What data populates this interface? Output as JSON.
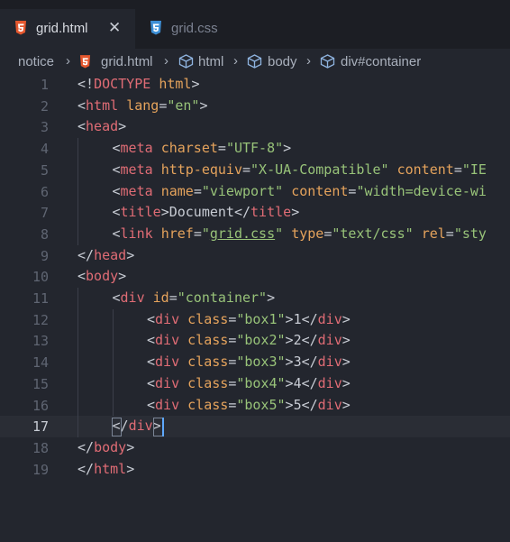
{
  "tabs": [
    {
      "label": "grid.html",
      "icon": "html5-icon",
      "active": true,
      "close": "✕"
    },
    {
      "label": "grid.css",
      "icon": "css3-icon",
      "active": false
    }
  ],
  "breadcrumb": {
    "items": [
      "notice",
      "grid.html",
      "html",
      "body",
      "div#container"
    ],
    "separator": "›"
  },
  "editor": {
    "current_line": 17,
    "lines": [
      {
        "n": "1",
        "indent": 0,
        "tokens": [
          [
            "br",
            "<!"
          ],
          [
            "tag",
            "DOCTYPE"
          ],
          [
            "txt",
            " "
          ],
          [
            "attr",
            "html"
          ],
          [
            "br",
            ">"
          ]
        ]
      },
      {
        "n": "2",
        "indent": 0,
        "tokens": [
          [
            "br",
            "<"
          ],
          [
            "tag",
            "html"
          ],
          [
            "txt",
            " "
          ],
          [
            "attr",
            "lang"
          ],
          [
            "br",
            "="
          ],
          [
            "str",
            "\"en\""
          ],
          [
            "br",
            ">"
          ]
        ]
      },
      {
        "n": "3",
        "indent": 0,
        "tokens": [
          [
            "br",
            "<"
          ],
          [
            "tag",
            "head"
          ],
          [
            "br",
            ">"
          ]
        ]
      },
      {
        "n": "4",
        "indent": 1,
        "tokens": [
          [
            "br",
            "<"
          ],
          [
            "tag",
            "meta"
          ],
          [
            "txt",
            " "
          ],
          [
            "attr",
            "charset"
          ],
          [
            "br",
            "="
          ],
          [
            "str",
            "\"UTF-8\""
          ],
          [
            "br",
            ">"
          ]
        ]
      },
      {
        "n": "5",
        "indent": 1,
        "tokens": [
          [
            "br",
            "<"
          ],
          [
            "tag",
            "meta"
          ],
          [
            "txt",
            " "
          ],
          [
            "attr",
            "http-equiv"
          ],
          [
            "br",
            "="
          ],
          [
            "str",
            "\"X-UA-Compatible\""
          ],
          [
            "txt",
            " "
          ],
          [
            "attr",
            "content"
          ],
          [
            "br",
            "="
          ],
          [
            "str",
            "\"IE"
          ]
        ]
      },
      {
        "n": "6",
        "indent": 1,
        "tokens": [
          [
            "br",
            "<"
          ],
          [
            "tag",
            "meta"
          ],
          [
            "txt",
            " "
          ],
          [
            "attr",
            "name"
          ],
          [
            "br",
            "="
          ],
          [
            "str",
            "\"viewport\""
          ],
          [
            "txt",
            " "
          ],
          [
            "attr",
            "content"
          ],
          [
            "br",
            "="
          ],
          [
            "str",
            "\"width=device-wi"
          ]
        ]
      },
      {
        "n": "7",
        "indent": 1,
        "tokens": [
          [
            "br",
            "<"
          ],
          [
            "tag",
            "title"
          ],
          [
            "br",
            ">"
          ],
          [
            "txt",
            "Document"
          ],
          [
            "br",
            "</"
          ],
          [
            "tag",
            "title"
          ],
          [
            "br",
            ">"
          ]
        ]
      },
      {
        "n": "8",
        "indent": 1,
        "tokens": [
          [
            "br",
            "<"
          ],
          [
            "tag",
            "link"
          ],
          [
            "txt",
            " "
          ],
          [
            "attr",
            "href"
          ],
          [
            "br",
            "="
          ],
          [
            "str",
            "\""
          ],
          [
            "link",
            "grid.css"
          ],
          [
            "str",
            "\""
          ],
          [
            "txt",
            " "
          ],
          [
            "attr",
            "type"
          ],
          [
            "br",
            "="
          ],
          [
            "str",
            "\"text/css\""
          ],
          [
            "txt",
            " "
          ],
          [
            "attr",
            "rel"
          ],
          [
            "br",
            "="
          ],
          [
            "str",
            "\"sty"
          ]
        ]
      },
      {
        "n": "9",
        "indent": 0,
        "tokens": [
          [
            "br",
            "</"
          ],
          [
            "tag",
            "head"
          ],
          [
            "br",
            ">"
          ]
        ]
      },
      {
        "n": "10",
        "indent": 0,
        "tokens": [
          [
            "br",
            "<"
          ],
          [
            "tag",
            "body"
          ],
          [
            "br",
            ">"
          ]
        ]
      },
      {
        "n": "11",
        "indent": 1,
        "tokens": [
          [
            "br",
            "<"
          ],
          [
            "tag",
            "div"
          ],
          [
            "txt",
            " "
          ],
          [
            "attr",
            "id"
          ],
          [
            "br",
            "="
          ],
          [
            "str",
            "\"container\""
          ],
          [
            "br",
            ">"
          ]
        ]
      },
      {
        "n": "12",
        "indent": 2,
        "tokens": [
          [
            "br",
            "<"
          ],
          [
            "tag",
            "div"
          ],
          [
            "txt",
            " "
          ],
          [
            "attr",
            "class"
          ],
          [
            "br",
            "="
          ],
          [
            "str",
            "\"box1\""
          ],
          [
            "br",
            ">"
          ],
          [
            "txt",
            "1"
          ],
          [
            "br",
            "</"
          ],
          [
            "tag",
            "div"
          ],
          [
            "br",
            ">"
          ]
        ]
      },
      {
        "n": "13",
        "indent": 2,
        "tokens": [
          [
            "br",
            "<"
          ],
          [
            "tag",
            "div"
          ],
          [
            "txt",
            " "
          ],
          [
            "attr",
            "class"
          ],
          [
            "br",
            "="
          ],
          [
            "str",
            "\"box2\""
          ],
          [
            "br",
            ">"
          ],
          [
            "txt",
            "2"
          ],
          [
            "br",
            "</"
          ],
          [
            "tag",
            "div"
          ],
          [
            "br",
            ">"
          ]
        ]
      },
      {
        "n": "14",
        "indent": 2,
        "tokens": [
          [
            "br",
            "<"
          ],
          [
            "tag",
            "div"
          ],
          [
            "txt",
            " "
          ],
          [
            "attr",
            "class"
          ],
          [
            "br",
            "="
          ],
          [
            "str",
            "\"box3\""
          ],
          [
            "br",
            ">"
          ],
          [
            "txt",
            "3"
          ],
          [
            "br",
            "</"
          ],
          [
            "tag",
            "div"
          ],
          [
            "br",
            ">"
          ]
        ]
      },
      {
        "n": "15",
        "indent": 2,
        "tokens": [
          [
            "br",
            "<"
          ],
          [
            "tag",
            "div"
          ],
          [
            "txt",
            " "
          ],
          [
            "attr",
            "class"
          ],
          [
            "br",
            "="
          ],
          [
            "str",
            "\"box4\""
          ],
          [
            "br",
            ">"
          ],
          [
            "txt",
            "4"
          ],
          [
            "br",
            "</"
          ],
          [
            "tag",
            "div"
          ],
          [
            "br",
            ">"
          ]
        ]
      },
      {
        "n": "16",
        "indent": 2,
        "tokens": [
          [
            "br",
            "<"
          ],
          [
            "tag",
            "div"
          ],
          [
            "txt",
            " "
          ],
          [
            "attr",
            "class"
          ],
          [
            "br",
            "="
          ],
          [
            "str",
            "\"box5\""
          ],
          [
            "br",
            ">"
          ],
          [
            "txt",
            "5"
          ],
          [
            "br",
            "</"
          ],
          [
            "tag",
            "div"
          ],
          [
            "br",
            ">"
          ]
        ]
      },
      {
        "n": "17",
        "indent": 1,
        "tokens": [
          [
            "br",
            "</"
          ],
          [
            "tag",
            "div"
          ],
          [
            "br",
            ">"
          ]
        ]
      },
      {
        "n": "18",
        "indent": 0,
        "tokens": [
          [
            "br",
            "</"
          ],
          [
            "tag",
            "body"
          ],
          [
            "br",
            ">"
          ]
        ]
      },
      {
        "n": "19",
        "indent": 0,
        "tokens": [
          [
            "br",
            "</"
          ],
          [
            "tag",
            "html"
          ],
          [
            "br",
            ">"
          ]
        ]
      }
    ]
  },
  "colors": {
    "background": "#23262e",
    "tabbar": "#1c1e24",
    "tag": "#e06c75",
    "attribute": "#e5a35c",
    "string": "#98c379",
    "cursor": "#5ea8ff"
  }
}
